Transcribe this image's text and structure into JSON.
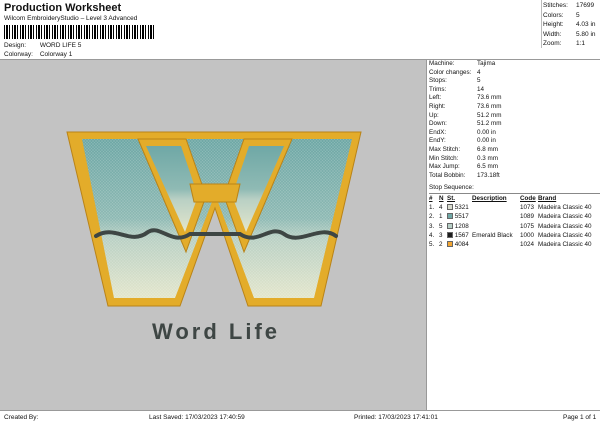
{
  "header": {
    "title": "Production Worksheet",
    "subtitle": "Wilcom EmbroideryStudio – Level 3 Advanced",
    "design_label": "Design:",
    "design_value": "WORD LIFE 5",
    "colorway_label": "Colorway:",
    "colorway_value": "Colorway 1"
  },
  "stats": [
    {
      "label": "Stitches:",
      "value": "17699"
    },
    {
      "label": "Colors:",
      "value": "5"
    },
    {
      "label": "Height:",
      "value": "4.03 in"
    },
    {
      "label": "Width:",
      "value": "5.80 in"
    },
    {
      "label": "Zoom:",
      "value": "1:1"
    }
  ],
  "details": [
    {
      "label": "Machine:",
      "value": "Tajima"
    },
    {
      "label": "Color changes:",
      "value": "4"
    },
    {
      "label": "Stops:",
      "value": "5"
    },
    {
      "label": "Trims:",
      "value": "14"
    },
    {
      "label": "Left:",
      "value": "73.6 mm"
    },
    {
      "label": "Right:",
      "value": "73.6 mm"
    },
    {
      "label": "Up:",
      "value": "51.2 mm"
    },
    {
      "label": "Down:",
      "value": "51.2 mm"
    },
    {
      "label": "EndX:",
      "value": "0.00 in"
    },
    {
      "label": "EndY:",
      "value": "0.00 in"
    },
    {
      "label": "Max Stitch:",
      "value": "6.8 mm"
    },
    {
      "label": "Min Stitch:",
      "value": "0.3 mm"
    },
    {
      "label": "Max Jump:",
      "value": "6.5 mm"
    },
    {
      "label": "Total Bobbin:",
      "value": "173.18ft"
    }
  ],
  "sequence": {
    "title": "Stop Sequence:",
    "headers": {
      "num": "#",
      "n": "N",
      "st": "St.",
      "desc": "Description",
      "code": "Code",
      "brand": "Brand"
    },
    "rows": [
      {
        "num": "1.",
        "n": "4",
        "color": "#d9dccf",
        "st": "5321",
        "desc": "",
        "code": "1073",
        "brand": "Madeira Classic 40"
      },
      {
        "num": "2.",
        "n": "1",
        "color": "#6fa8a6",
        "st": "5517",
        "desc": "",
        "code": "1089",
        "brand": "Madeira Classic 40"
      },
      {
        "num": "3.",
        "n": "5",
        "color": "#b7cfc6",
        "st": "1208",
        "desc": "",
        "code": "1075",
        "brand": "Madeira Classic 40"
      },
      {
        "num": "4.",
        "n": "3",
        "color": "#1c1c1c",
        "st": "1567",
        "desc": "Emerald Black",
        "code": "1000",
        "brand": "Madeira Classic 40"
      },
      {
        "num": "5.",
        "n": "2",
        "color": "#f2a531",
        "st": "4084",
        "desc": "",
        "code": "1024",
        "brand": "Madeira Classic 40"
      }
    ]
  },
  "artwork": {
    "text": "Word Life",
    "colors": {
      "gold": "#e3ac2a",
      "teal": "#6fa8a6",
      "pale": "#d8dcc4",
      "dark": "#3e4644"
    }
  },
  "footer": {
    "created_by": "Created By:",
    "last_saved": "Last Saved: 17/03/2023 17:40:59",
    "printed": "Printed: 17/03/2023 17:41:01",
    "page": "Page 1 of 1"
  }
}
